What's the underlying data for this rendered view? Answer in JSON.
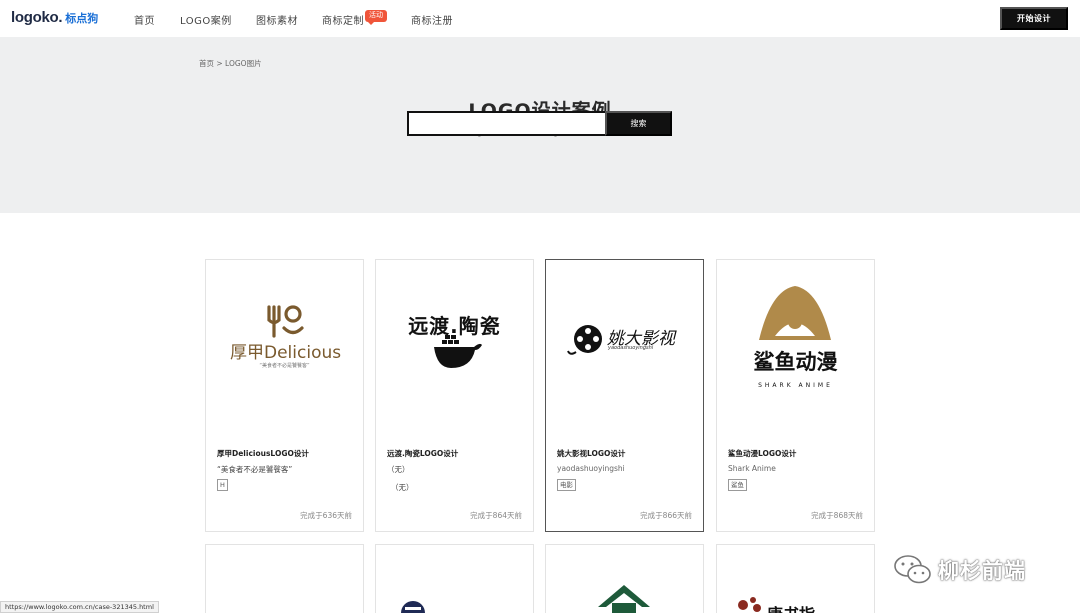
{
  "header": {
    "logo_en": "logoko.",
    "logo_cn": "标点狗",
    "nav": [
      "首页",
      "LOGO案例",
      "图标素材",
      "商标定制",
      "商标注册"
    ],
    "hot_badge": "活动",
    "start_button": "开始设计"
  },
  "hero": {
    "breadcrumb": "首页 > LOGO图片",
    "title": "LOGO设计案例",
    "subtitle": "为您找到63645个logo图片，选择喜欢的logo模板创意制作自己的品牌标志吧!",
    "search_placeholder": "",
    "search_button": "搜索"
  },
  "cards": [
    {
      "title": "厚甲DeliciousLOGO设计",
      "subtitle": "“美食者不必是饕餮客”",
      "tag": "H",
      "time": "完成于636天前",
      "logo_main": "厚甲",
      "logo_en": "Delicious",
      "logo_slogan": "“美食者不必是饕餮客”"
    },
    {
      "title": "远渡.陶瓷LOGO设计",
      "subtitle": "（无）",
      "subtitle2": "（无）",
      "time": "完成于864天前",
      "logo_main": "远渡.陶瓷"
    },
    {
      "title": "姚大影视LOGO设计",
      "subtitle": "yaodashuoyingshi",
      "tag": "电影",
      "time": "完成于866天前",
      "logo_main": "姚大影视",
      "logo_pinyin": "yaodashuoyingshi"
    },
    {
      "title": "鲨鱼动漫LOGO设计",
      "subtitle": "Shark Anime",
      "tag": "鲨鱼",
      "time": "完成于868天前",
      "logo_main": "鲨鱼动漫",
      "logo_en": "SHARK ANIME"
    }
  ],
  "card_row2_partial": {
    "logo_text": "唐书指"
  },
  "statusbar": {
    "url": "https://www.logoko.com.cn/case-321345.html"
  },
  "watermark": {
    "text": "柳杉前端"
  },
  "colors": {
    "accent_blue": "#1a6fd6",
    "hot_red": "#f0553a",
    "button_black": "#111111",
    "hero_bg": "#eeeff0",
    "brown": "#7a5a2e",
    "gold": "#b08a4a"
  }
}
